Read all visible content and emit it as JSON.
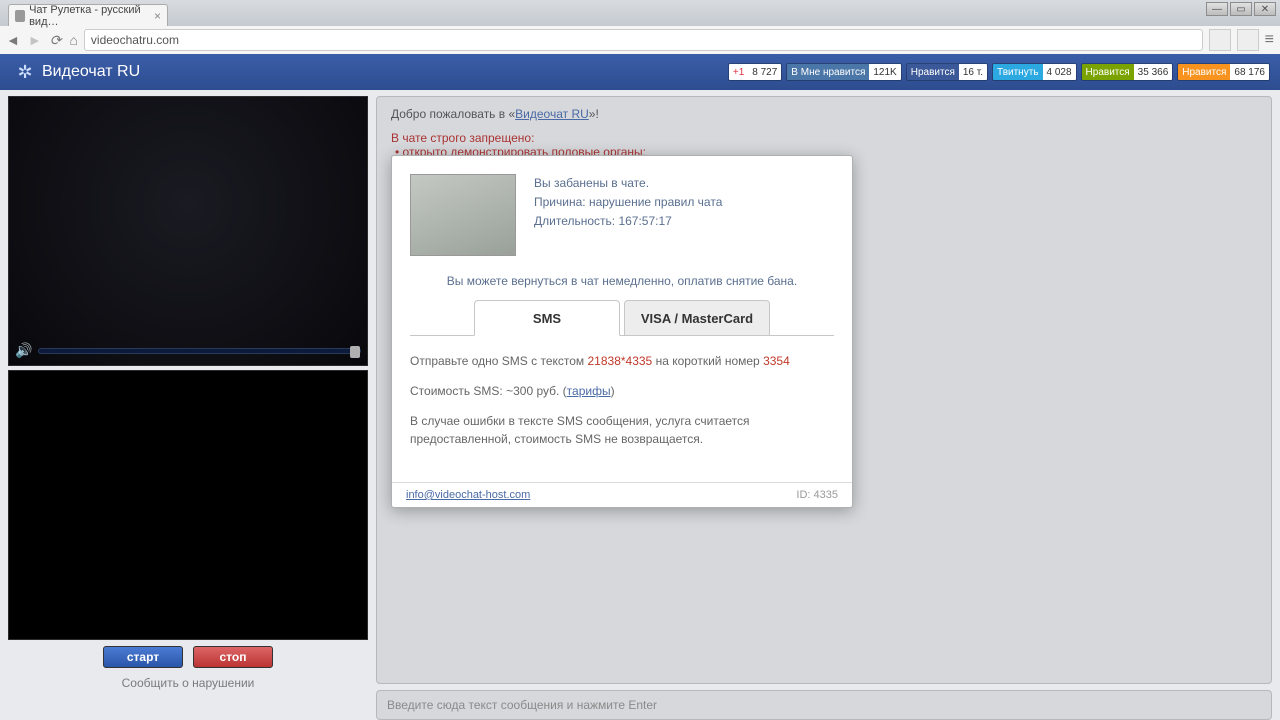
{
  "browser": {
    "tab_title": "Чат Рулетка - русский вид…",
    "url": "videochatru.com"
  },
  "header": {
    "site_title": "Видеочат RU",
    "social": {
      "gplus_label": "+1",
      "gplus_count": "8 727",
      "vk_label": "Мне нравится",
      "vk_count": "121K",
      "fb_label": "Нравится",
      "fb_count": "16 т.",
      "tw_label": "Твитнуть",
      "tw_count": "4 028",
      "ok_label": "Нравится",
      "ok_count": "35 366",
      "od_label": "Нравится",
      "od_count": "68 176"
    }
  },
  "controls": {
    "start": "старт",
    "stop": "стоп",
    "report": "Сообщить о нарушении"
  },
  "chat": {
    "welcome_prefix": "Добро пожаловать в «",
    "welcome_link": "Видеочат RU",
    "welcome_suffix": "»!",
    "rules_title": "В чате строго запрещено:",
    "rule1": "• открыто демонстрировать половые органы;",
    "rule2": "•",
    "input_placeholder": "Введите сюда текст сообщения и нажмите Enter"
  },
  "modal": {
    "ban_line1": "Вы забанены в чате.",
    "ban_line2_label": "Причина: ",
    "ban_line2_value": "нарушение правил чата",
    "ban_line3_label": "Длительность: ",
    "ban_line3_value": "167:57:17",
    "return_msg": "Вы можете вернуться в чат немедленно, оплатив снятие бана.",
    "tab_sms": "SMS",
    "tab_card": "VISA / MasterCard",
    "sms_text1a": "Отправьте одно SMS с текстом ",
    "sms_code": "21838*4335",
    "sms_text1b": " на короткий номер ",
    "sms_short": "3354",
    "sms_cost_a": "Стоимость SMS: ~300 руб. (",
    "sms_cost_link": "тарифы",
    "sms_cost_b": ")",
    "sms_warn": "В случае ошибки в тексте SMS сообщения, услуга считается предоставленной, стоимость SMS не возвращается.",
    "footer_email": "info@videochat-host.com",
    "footer_id": "ID: 4335"
  }
}
